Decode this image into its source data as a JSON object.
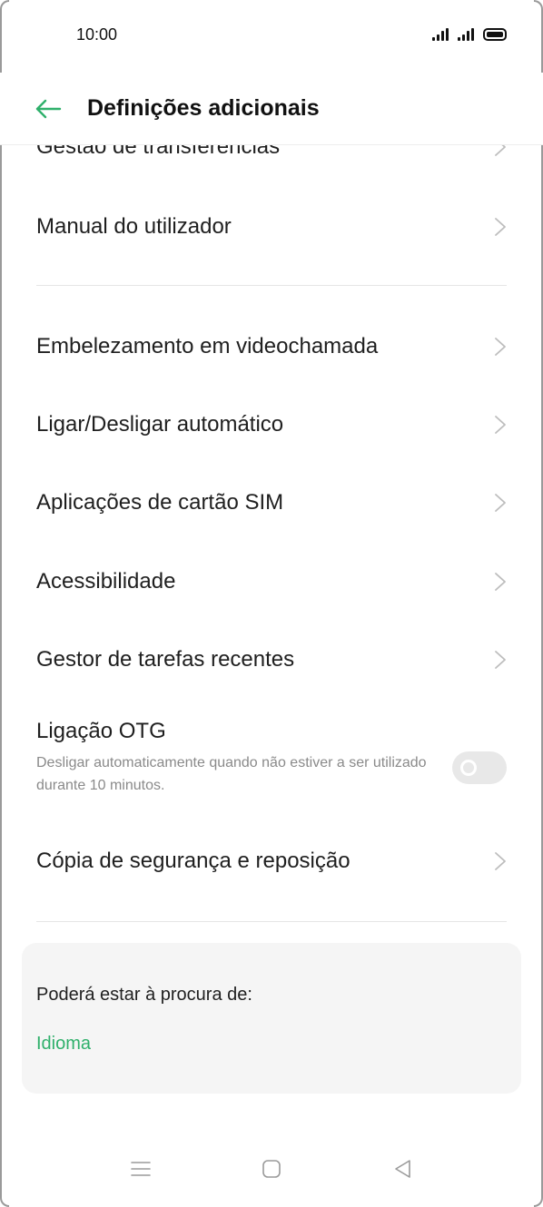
{
  "status_bar": {
    "time": "10:00",
    "icons": [
      "signal-icon",
      "signal-icon",
      "battery-icon"
    ]
  },
  "header": {
    "title": "Definições adicionais",
    "back_icon": "arrow-left-icon"
  },
  "list": {
    "partial_item": "Gestão de transferências",
    "manual": "Manual do utilizador",
    "beauty": "Embelezamento em videochamada",
    "power": "Ligar/Desligar automático",
    "sim": "Aplicações de cartão SIM",
    "accessibility": "Acessibilidade",
    "recent": "Gestor de tarefas recentes",
    "otg": {
      "label": "Ligação OTG",
      "description": "Desligar automaticamente quando não estiver a ser utilizado durante 10 minutos.",
      "enabled": false
    },
    "backup": "Cópia de segurança e reposição"
  },
  "suggestions": {
    "title": "Poderá estar à procura de:",
    "link": "Idioma"
  },
  "colors": {
    "accent": "#2fb06b",
    "text": "#1f1f1f",
    "secondary_text": "#8a8a8a",
    "card_bg": "#f5f5f5",
    "toggle_off": "#e8e8e8"
  },
  "nav_bar": {
    "icons": [
      "menu-icon",
      "home-square-icon",
      "back-triangle-icon"
    ]
  }
}
